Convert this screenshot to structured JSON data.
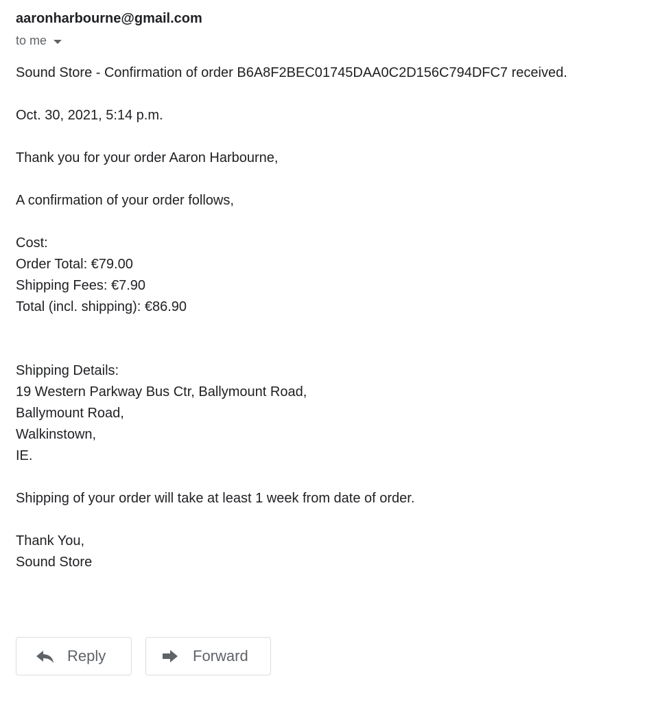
{
  "message": {
    "sender": "aaronharbourne@gmail.com",
    "recipient_label": "to me",
    "lines": {
      "subject": "Sound Store - Confirmation of order B6A8F2BEC01745DAA0C2D156C794DFC7 received.",
      "date": "Oct. 30, 2021, 5:14 p.m.",
      "greeting": "Thank you for your order Aaron Harbourne,",
      "intro": "A confirmation of your order follows,",
      "cost_heading": "Cost:",
      "order_total": "Order Total: €79.00",
      "shipping_fees": "Shipping Fees: €7.90",
      "grand_total": "Total (incl. shipping): €86.90",
      "shipping_heading": "Shipping Details:",
      "address_line1": "19 Western Parkway Bus Ctr, Ballymount Road,",
      "address_line2": "Ballymount Road,",
      "address_line3": "Walkinstown,",
      "address_line4": "IE.",
      "shipping_note": "Shipping of your order will take at least 1 week from date of order.",
      "signoff": "Thank You,",
      "signature": "Sound Store"
    }
  },
  "actions": {
    "reply_label": "Reply",
    "forward_label": "Forward"
  },
  "icons": {
    "recipient_caret": "caret-down-icon",
    "reply": "reply-icon",
    "forward": "forward-icon"
  },
  "colors": {
    "text": "#202124",
    "secondary_text": "#5f6368",
    "button_border": "#dadce0"
  }
}
